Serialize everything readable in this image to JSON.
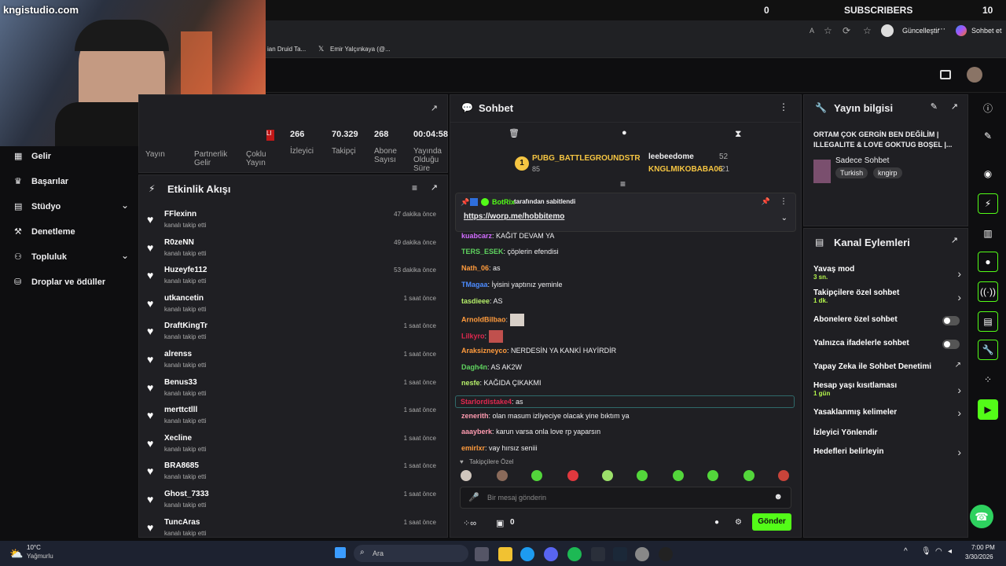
{
  "overlay": {
    "brand": "kngistudio.com",
    "sub_count": "0",
    "sub_label": "SUBSCRIBERS",
    "sub_goal": "10"
  },
  "browser": {
    "update_label": "Güncelleştir",
    "chat_label": "Sohbet et",
    "bookmarks": [
      "ian Druid Ta...",
      "Emir Yalçınkaya (@..."
    ]
  },
  "stats": {
    "values": [
      {
        "v": "266",
        "l": "İzleyici"
      },
      {
        "v": "70.329",
        "l": "Takipçi"
      },
      {
        "v": "268",
        "l": "Abone Sayısı"
      },
      {
        "v": "00:04:58",
        "l": "Yayında Olduğu Süre"
      }
    ],
    "lower_labels": [
      "Yayın",
      "Partnerlik Gelir",
      "Çoklu Yayın"
    ]
  },
  "sidebar": {
    "items": [
      {
        "label": "Gelir"
      },
      {
        "label": "Başarılar"
      },
      {
        "label": "Stüdyo"
      },
      {
        "label": "Denetleme"
      },
      {
        "label": "Topluluk"
      },
      {
        "label": "Droplar ve ödüller"
      }
    ]
  },
  "activity": {
    "title": "Etkinlik Akışı",
    "events": [
      {
        "name": "FFlexinn",
        "sub": "kanalı takip etti",
        "time": "47 dakika önce"
      },
      {
        "name": "R0zeNN",
        "sub": "kanalı takip etti",
        "time": "49 dakika önce"
      },
      {
        "name": "Huzeyfe112",
        "sub": "kanalı takip etti",
        "time": "53 dakika önce"
      },
      {
        "name": "utkancetin",
        "sub": "kanalı takip etti",
        "time": "1 saat önce"
      },
      {
        "name": "DraftKingTr",
        "sub": "kanalı takip etti",
        "time": "1 saat önce"
      },
      {
        "name": "alrenss",
        "sub": "kanalı takip etti",
        "time": "1 saat önce"
      },
      {
        "name": "Benus33",
        "sub": "kanalı takip etti",
        "time": "1 saat önce"
      },
      {
        "name": "merttctlll",
        "sub": "kanalı takip etti",
        "time": "1 saat önce"
      },
      {
        "name": "Xecline",
        "sub": "kanalı takip etti",
        "time": "1 saat önce"
      },
      {
        "name": "BRA8685",
        "sub": "kanalı takip etti",
        "time": "1 saat önce"
      },
      {
        "name": "Ghost_7333",
        "sub": "kanalı takip etti",
        "time": "1 saat önce"
      },
      {
        "name": "TuncAras",
        "sub": "kanalı takip etti",
        "time": "1 saat önce"
      }
    ]
  },
  "chat": {
    "title": "Sohbet",
    "leaders": [
      {
        "rank": "1",
        "name": "PUBG_BATTLEGROUNDSTR",
        "pts": "85"
      },
      {
        "name": "leebeedome",
        "pts": "52"
      },
      {
        "name": "KNGLMIKOBABA06",
        "pts": "21"
      }
    ],
    "pinned_by": "BotRix",
    "pinned_suffix": "tarafından sabitlendi",
    "pinned_link": "https://worp.me/hobbitemo",
    "messages": [
      {
        "user": "kuabcarz",
        "color": "#d26cff",
        "text": "KAĞIT DEVAM YA"
      },
      {
        "user": "TERS_ESEK",
        "color": "#5fd35f",
        "text": "çöplerin efendisi"
      },
      {
        "user": "Nath_06",
        "color": "#ff9b3d",
        "text": "as"
      },
      {
        "user": "TMagaa",
        "color": "#4c8cff",
        "text": "İyisini yaptınız yeminle"
      },
      {
        "user": "tasdieee",
        "color": "#b6f06a",
        "text": "AS"
      },
      {
        "user": "ArnoldBilbao",
        "color": "#ff9b3d",
        "text": ""
      },
      {
        "user": "Lilkyro",
        "color": "#e0284f",
        "text": ""
      },
      {
        "user": "Araksizneyco",
        "color": "#ff9b3d",
        "text": "NERDESİN YA KANKİ HAYİRDİR"
      },
      {
        "user": "Dagh4n",
        "color": "#5fd35f",
        "text": "AS AK2W"
      },
      {
        "user": "nesfe",
        "color": "#b6f06a",
        "text": "KAĞIDA ÇIKAKMI"
      },
      {
        "user": "Starlordistake4",
        "color": "#e0284f",
        "text": "as"
      },
      {
        "user": "zenerith",
        "color": "#ff9bb0",
        "text": "olan masum izliyeciye olacak yine bıktım ya"
      },
      {
        "user": "aaayberk",
        "color": "#ff9bb0",
        "text": "karun varsa onla love rp yaparsın"
      },
      {
        "user": "emirlxr",
        "color": "#ff9b3d",
        "text": "vay hırsız seniii"
      }
    ],
    "followers_only": "Takipçilere Özel",
    "input_placeholder": "Bir mesaj gönderin",
    "points": "0",
    "send_label": "Gönder"
  },
  "stream_info": {
    "title": "Yayın bilgisi",
    "stream_title": "ORTAM ÇOK GERGİN BEN DEĞİLİM | ILLEGALITE & LOVE GOKTUG BOŞEL |...",
    "category": "Sadece Sohbet",
    "tags": [
      "Turkish",
      "kngirp"
    ]
  },
  "actions": {
    "title": "Kanal Eylemleri",
    "items": [
      {
        "label": "Yavaş mod",
        "sub": "3 sn."
      },
      {
        "label": "Takipçilere özel sohbet",
        "sub": "1 dk."
      },
      {
        "label": "Abonelere özel sohbet",
        "sub": ""
      },
      {
        "label": "Yalnızca ifadelerle sohbet",
        "sub": ""
      },
      {
        "label": "Yapay Zeka ile Sohbet Denetimi",
        "sub": ""
      },
      {
        "label": "Hesap yaşı kısıtlaması",
        "sub": "1 gün"
      },
      {
        "label": "Yasaklanmış kelimeler",
        "sub": ""
      },
      {
        "label": "İzleyici Yönlendir",
        "sub": ""
      },
      {
        "label": "Hedefleri belirleyin",
        "sub": ""
      }
    ]
  },
  "taskbar": {
    "temp": "10°C",
    "weather": "Yağmurlu",
    "search": "Ara",
    "time": "7:00 PM",
    "date": "3/30/2026"
  },
  "colors": {
    "accent": "#53fc18",
    "bg": "#0e0e10",
    "panel": "#1f1f23"
  }
}
